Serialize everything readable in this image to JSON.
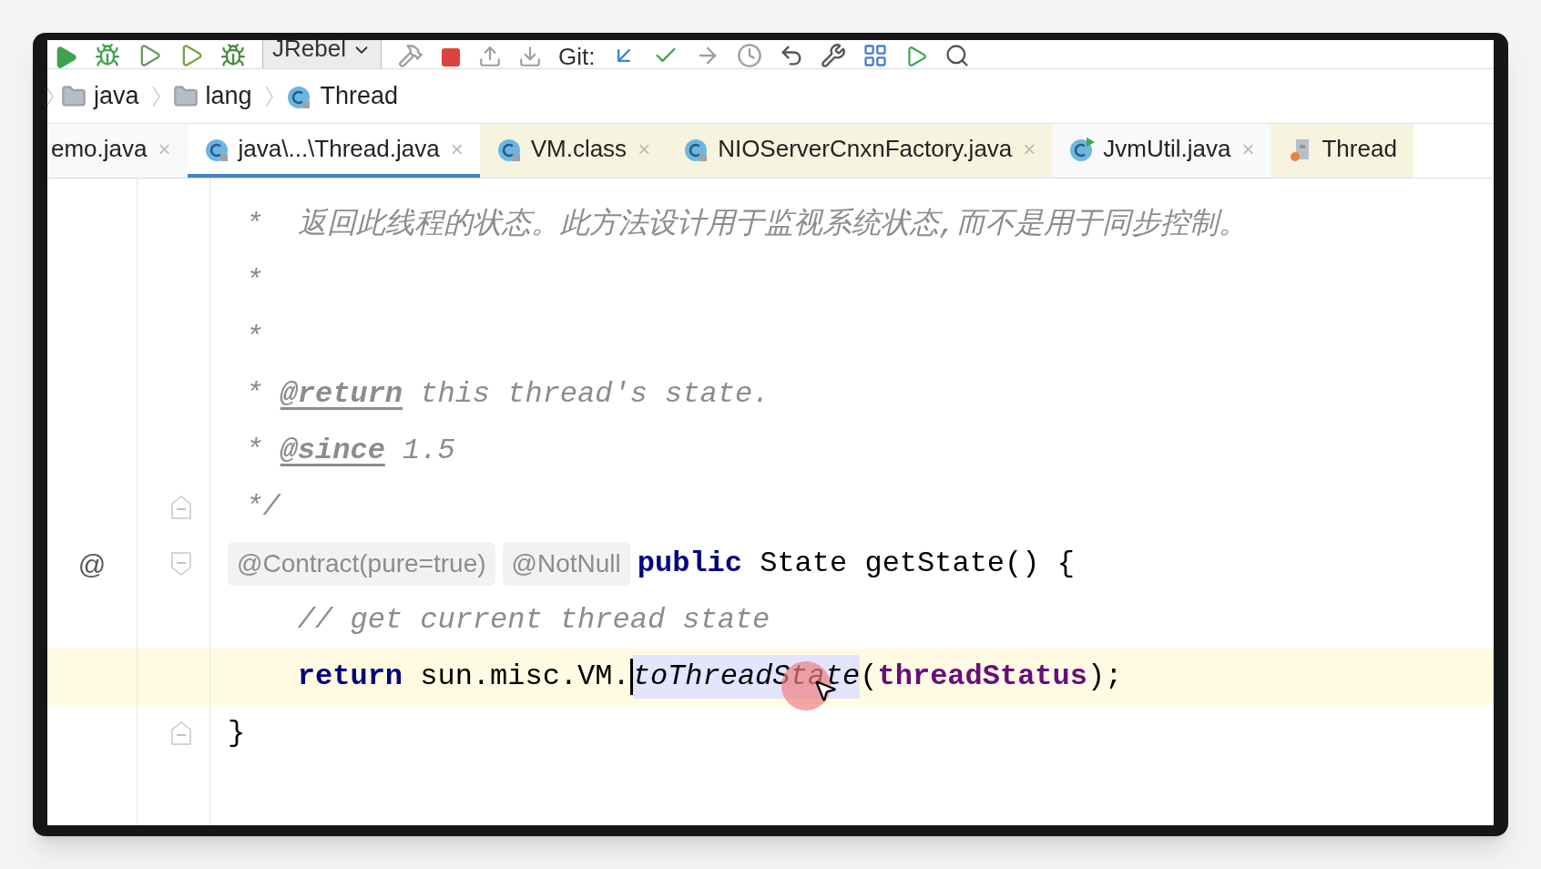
{
  "toolbar": {
    "run_config": "JRebel",
    "vcs_label": "Git:"
  },
  "breadcrumbs": [
    {
      "label": "java",
      "kind": "folder"
    },
    {
      "label": "lang",
      "kind": "folder"
    },
    {
      "label": "Thread",
      "kind": "class"
    }
  ],
  "tabs": [
    {
      "label": "emo.java",
      "close": "×",
      "selected": false,
      "library": false,
      "kind": "plain"
    },
    {
      "label": "java\\...\\Thread.java",
      "close": "×",
      "selected": true,
      "library": false,
      "kind": "class"
    },
    {
      "label": "VM.class",
      "close": "×",
      "selected": false,
      "library": true,
      "kind": "class"
    },
    {
      "label": "NIOServerCnxnFactory.java",
      "close": "×",
      "selected": false,
      "library": true,
      "kind": "class"
    },
    {
      "label": "JvmUtil.java",
      "close": "×",
      "selected": false,
      "library": false,
      "kind": "runnable"
    },
    {
      "label": "Thread",
      "selected": false,
      "library": true,
      "kind": "archive"
    }
  ],
  "code_lines": [
    {
      "current": false,
      "fold_start": false,
      "fold_end": false,
      "tokens": [
        {
          "text": " *  返回此线程的状态。此方法设计用于监视系统状态,而不是用于同步控制。",
          "kind": "comment"
        }
      ]
    },
    {
      "current": false,
      "fold_start": false,
      "fold_end": false,
      "tokens": [
        {
          "text": " *",
          "kind": "comment"
        }
      ]
    },
    {
      "current": false,
      "fold_start": false,
      "fold_end": false,
      "tokens": [
        {
          "text": " *",
          "kind": "comment"
        }
      ]
    },
    {
      "current": false,
      "fold_start": false,
      "fold_end": false,
      "tokens": [
        {
          "text": " * ",
          "kind": "comment"
        },
        {
          "text": "@return",
          "kind": "doctag"
        },
        {
          "text": " this thread's state.",
          "kind": "comment"
        }
      ]
    },
    {
      "current": false,
      "fold_start": false,
      "fold_end": false,
      "tokens": [
        {
          "text": " * ",
          "kind": "comment"
        },
        {
          "text": "@since",
          "kind": "doctag"
        },
        {
          "text": " 1.5",
          "kind": "comment"
        }
      ]
    },
    {
      "current": false,
      "fold_start": false,
      "fold_end": true,
      "tokens": [
        {
          "text": " */",
          "kind": "comment"
        }
      ]
    },
    {
      "current": false,
      "fold_start": true,
      "fold_end": false,
      "gutter_mark": "@",
      "tokens": [
        {
          "text": "@Contract(pure=true)",
          "kind": "inlay"
        },
        {
          "text": "@NotNull",
          "kind": "inlay"
        },
        {
          "text": "public",
          "kind": "keyword"
        },
        {
          "text": " State getState() {",
          "kind": "plain"
        }
      ]
    },
    {
      "current": false,
      "fold_start": false,
      "fold_end": false,
      "tokens": [
        {
          "text": "    // get current thread state",
          "kind": "comment"
        }
      ]
    },
    {
      "current": true,
      "fold_start": false,
      "fold_end": false,
      "tokens": [
        {
          "text": "    return",
          "kind": "keyword"
        },
        {
          "text": " sun.misc.VM.",
          "kind": "plain"
        },
        {
          "text": "toThreadState",
          "kind": "static-call",
          "caret": true
        },
        {
          "text": "(",
          "kind": "plain"
        },
        {
          "text": "threadStatus",
          "kind": "field"
        },
        {
          "text": ");",
          "kind": "plain"
        }
      ]
    },
    {
      "current": false,
      "fold_start": false,
      "fold_end": true,
      "tokens": [
        {
          "text": "}",
          "kind": "plain"
        }
      ]
    }
  ]
}
